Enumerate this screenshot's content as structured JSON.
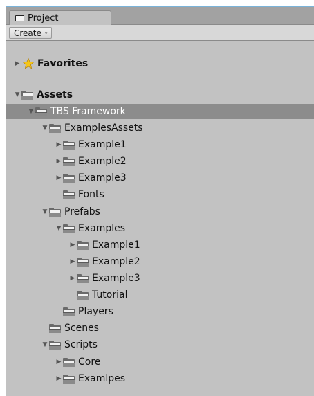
{
  "window": {
    "tab_label": "Project",
    "tab_icon": "project-folder-icon"
  },
  "toolbar": {
    "create_label": "Create",
    "create_caret": "▾"
  },
  "colors": {
    "selected_row": "#8c8c8c",
    "panel_bg": "#c2c2c2",
    "tabbar_bg": "#a2a2a2",
    "favorites_star": "#f5c518"
  },
  "tree": [
    {
      "label": "Favorites",
      "depth": 0,
      "icon": "star-icon",
      "expanded": false,
      "has_children": true,
      "bold": true
    },
    {
      "label": "Assets",
      "depth": 0,
      "icon": "folder-icon",
      "expanded": true,
      "has_children": true,
      "bold": true
    },
    {
      "label": "TBS Framework",
      "depth": 1,
      "icon": "folder-icon",
      "expanded": true,
      "has_children": true,
      "selected": true
    },
    {
      "label": "ExamplesAssets",
      "depth": 2,
      "icon": "folder-icon",
      "expanded": true,
      "has_children": true
    },
    {
      "label": "Example1",
      "depth": 3,
      "icon": "folder-icon",
      "expanded": false,
      "has_children": true
    },
    {
      "label": "Example2",
      "depth": 3,
      "icon": "folder-icon",
      "expanded": false,
      "has_children": true
    },
    {
      "label": "Example3",
      "depth": 3,
      "icon": "folder-icon",
      "expanded": false,
      "has_children": true
    },
    {
      "label": "Fonts",
      "depth": 3,
      "icon": "folder-icon",
      "expanded": false,
      "has_children": false
    },
    {
      "label": "Prefabs",
      "depth": 2,
      "icon": "folder-icon",
      "expanded": true,
      "has_children": true
    },
    {
      "label": "Examples",
      "depth": 3,
      "icon": "folder-icon",
      "expanded": true,
      "has_children": true
    },
    {
      "label": "Example1",
      "depth": 4,
      "icon": "folder-icon",
      "expanded": false,
      "has_children": true
    },
    {
      "label": "Example2",
      "depth": 4,
      "icon": "folder-icon",
      "expanded": false,
      "has_children": true
    },
    {
      "label": "Example3",
      "depth": 4,
      "icon": "folder-icon",
      "expanded": false,
      "has_children": true
    },
    {
      "label": "Tutorial",
      "depth": 4,
      "icon": "folder-icon",
      "expanded": false,
      "has_children": false
    },
    {
      "label": "Players",
      "depth": 3,
      "icon": "folder-icon",
      "expanded": false,
      "has_children": false
    },
    {
      "label": "Scenes",
      "depth": 2,
      "icon": "folder-icon",
      "expanded": false,
      "has_children": false
    },
    {
      "label": "Scripts",
      "depth": 2,
      "icon": "folder-icon",
      "expanded": true,
      "has_children": true
    },
    {
      "label": "Core",
      "depth": 3,
      "icon": "folder-icon",
      "expanded": false,
      "has_children": true
    },
    {
      "label": "Examlpes",
      "depth": 3,
      "icon": "folder-icon",
      "expanded": false,
      "has_children": true
    }
  ]
}
